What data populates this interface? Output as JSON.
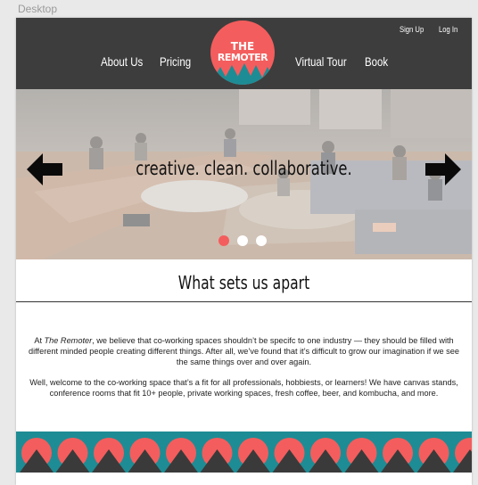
{
  "artboard": {
    "label": "Desktop"
  },
  "header": {
    "top_links": [
      "Sign Up",
      "Log In"
    ],
    "nav": [
      "About Us",
      "Pricing",
      "Virtual Tour",
      "Book"
    ],
    "logo": {
      "line1": "THE",
      "line2": "REMOTER",
      "icon": "mountain-sun-logo"
    }
  },
  "hero": {
    "tagline": "creative.  clean.  collaborative.",
    "prev_icon": "left-arrow-icon",
    "next_icon": "right-arrow-icon",
    "slide_count": 3,
    "active_slide": 1
  },
  "section": {
    "title": "What sets us apart",
    "paragraph1": {
      "before": "At ",
      "brand": "The Remoter",
      "after": ", we believe that co-working spaces shouldn’t be specifc to one industry — they should be filled with different minded people creating different things. After all, we’ve found that it’s difficult to grow our imagination if we see the same things over and over again."
    },
    "paragraph2": "Well, welcome to the co-working space that’s a fit for all professionals, hobbiests, or learners! We have canvas stands, conference rooms that fit 10+ people, private working spaces, fresh coffee, beer, and kombucha, and more."
  },
  "colors": {
    "header_bg": "#3d3d3d",
    "accent_coral": "#f45d5d",
    "band_teal": "#1e8c94",
    "mountain_dark": "#3a3a3a"
  }
}
